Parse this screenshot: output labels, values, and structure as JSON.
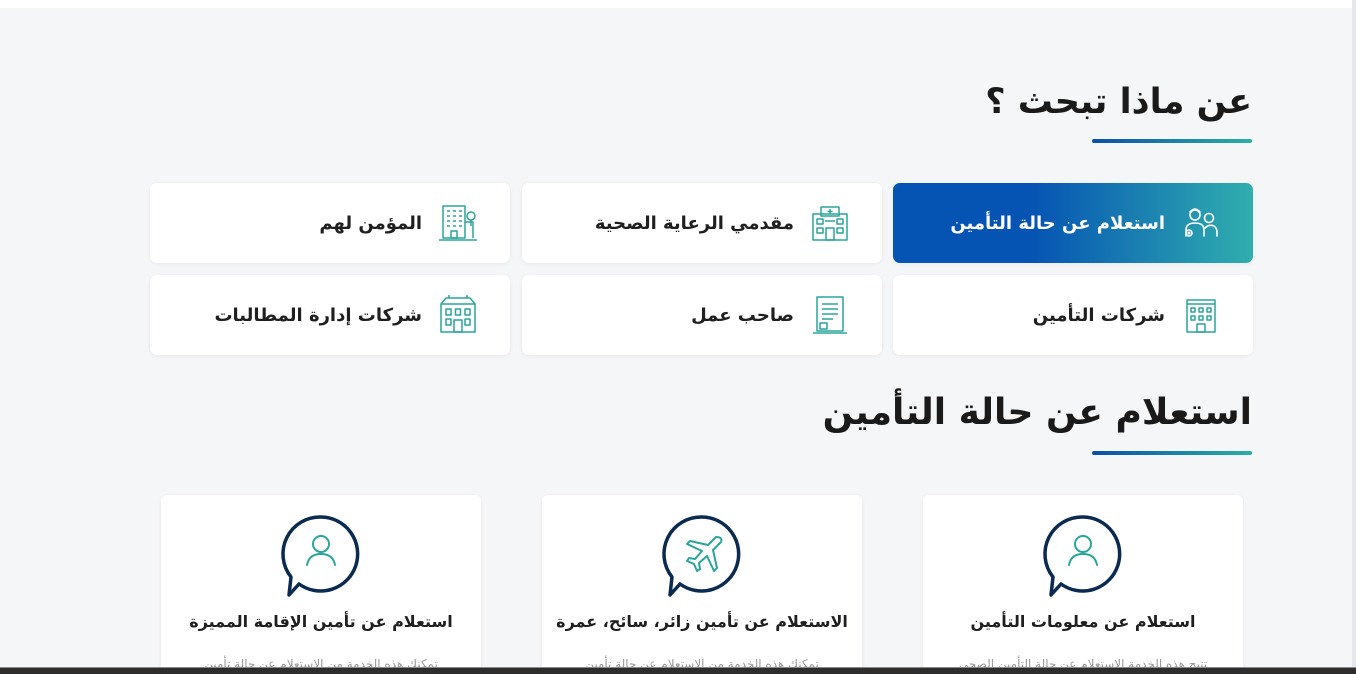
{
  "search_section": {
    "title": "عن ماذا تبحث ؟",
    "categories": [
      {
        "label": "استعلام عن حالة التأمين",
        "icon": "insurance-status-icon",
        "active": true
      },
      {
        "label": "مقدمي الرعاية الصحية",
        "icon": "hospital-icon",
        "active": false
      },
      {
        "label": "المؤمن لهم",
        "icon": "building-icon",
        "active": false
      },
      {
        "label": "شركات التأمين",
        "icon": "office-building-icon",
        "active": false
      },
      {
        "label": "صاحب عمل",
        "icon": "document-icon",
        "active": false
      },
      {
        "label": "شركات إدارة المطالبات",
        "icon": "company-building-icon",
        "active": false
      }
    ]
  },
  "status_section": {
    "title": "استعلام عن حالة التأمين",
    "services": [
      {
        "title": "استعلام عن معلومات التأمين",
        "description": "تتيح هذه الخدمة الاستعلام عن حالة التأمين الصحي",
        "icon": "user-chat-icon"
      },
      {
        "title": "الاستعلام عن تأمين زائر، سائح، عمرة",
        "description": "تمكنك هذه الخدمة من الاستعلام عن حالة تأمين",
        "icon": "airplane-chat-icon"
      },
      {
        "title": "استعلام عن تأمين الإقامة المميزة",
        "description": "تمكنك هذه الخدمة من الاستعلام عن حالة تأمين",
        "icon": "user-chat-icon"
      }
    ]
  },
  "colors": {
    "accent_start": "#0553b3",
    "accent_end": "#30aeae",
    "icon_teal": "#2aa59a",
    "icon_navy": "#0b2a4f"
  }
}
